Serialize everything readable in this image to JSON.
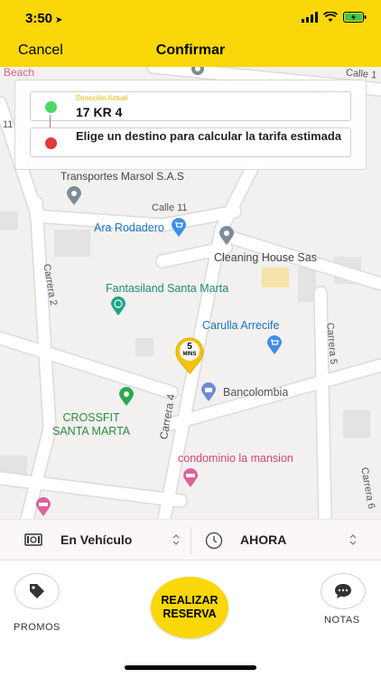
{
  "status_bar": {
    "time": "3:50"
  },
  "nav": {
    "cancel_label": "Cancel",
    "title": "Confirmar"
  },
  "map": {
    "pois": {
      "transportes": "Transportes Marsol S.A.S",
      "ara": "Ara Rodadero",
      "cleaning": "Cleaning House Sas",
      "fantasiland": "Fantasiland Santa Marta",
      "carulla": "Carulla Arrecife",
      "bancolombia": "Bancolombia",
      "crossfit": "CROSSFIT\nSANTA MARTA",
      "condominio": "condominio la mansion",
      "beach": "Beach"
    },
    "streets": {
      "calle11": "Calle 11",
      "calle_top": "Calle 1",
      "carrera2": "Carrera 2",
      "carrera4": "Carrera 4",
      "carrera5": "Carrera 5",
      "carrera6": "Carrera 6",
      "num11": "11"
    },
    "pin": {
      "value": "5",
      "unit": "MINS"
    }
  },
  "address": {
    "current_label": "Dirección Actual",
    "current_value": "17 KR 4",
    "destination_prompt": "Elige un destino para calcular la tarifa estimada"
  },
  "options": {
    "vehicle": "En Vehículo",
    "time": "AHORA"
  },
  "actions": {
    "promos": "PROMOS",
    "reserve": "REALIZAR RESERVA",
    "notes": "NOTAS"
  },
  "colors": {
    "accent": "#f9d708",
    "green": "#4cd964",
    "red": "#e0393e",
    "blue": "#2196f3"
  }
}
